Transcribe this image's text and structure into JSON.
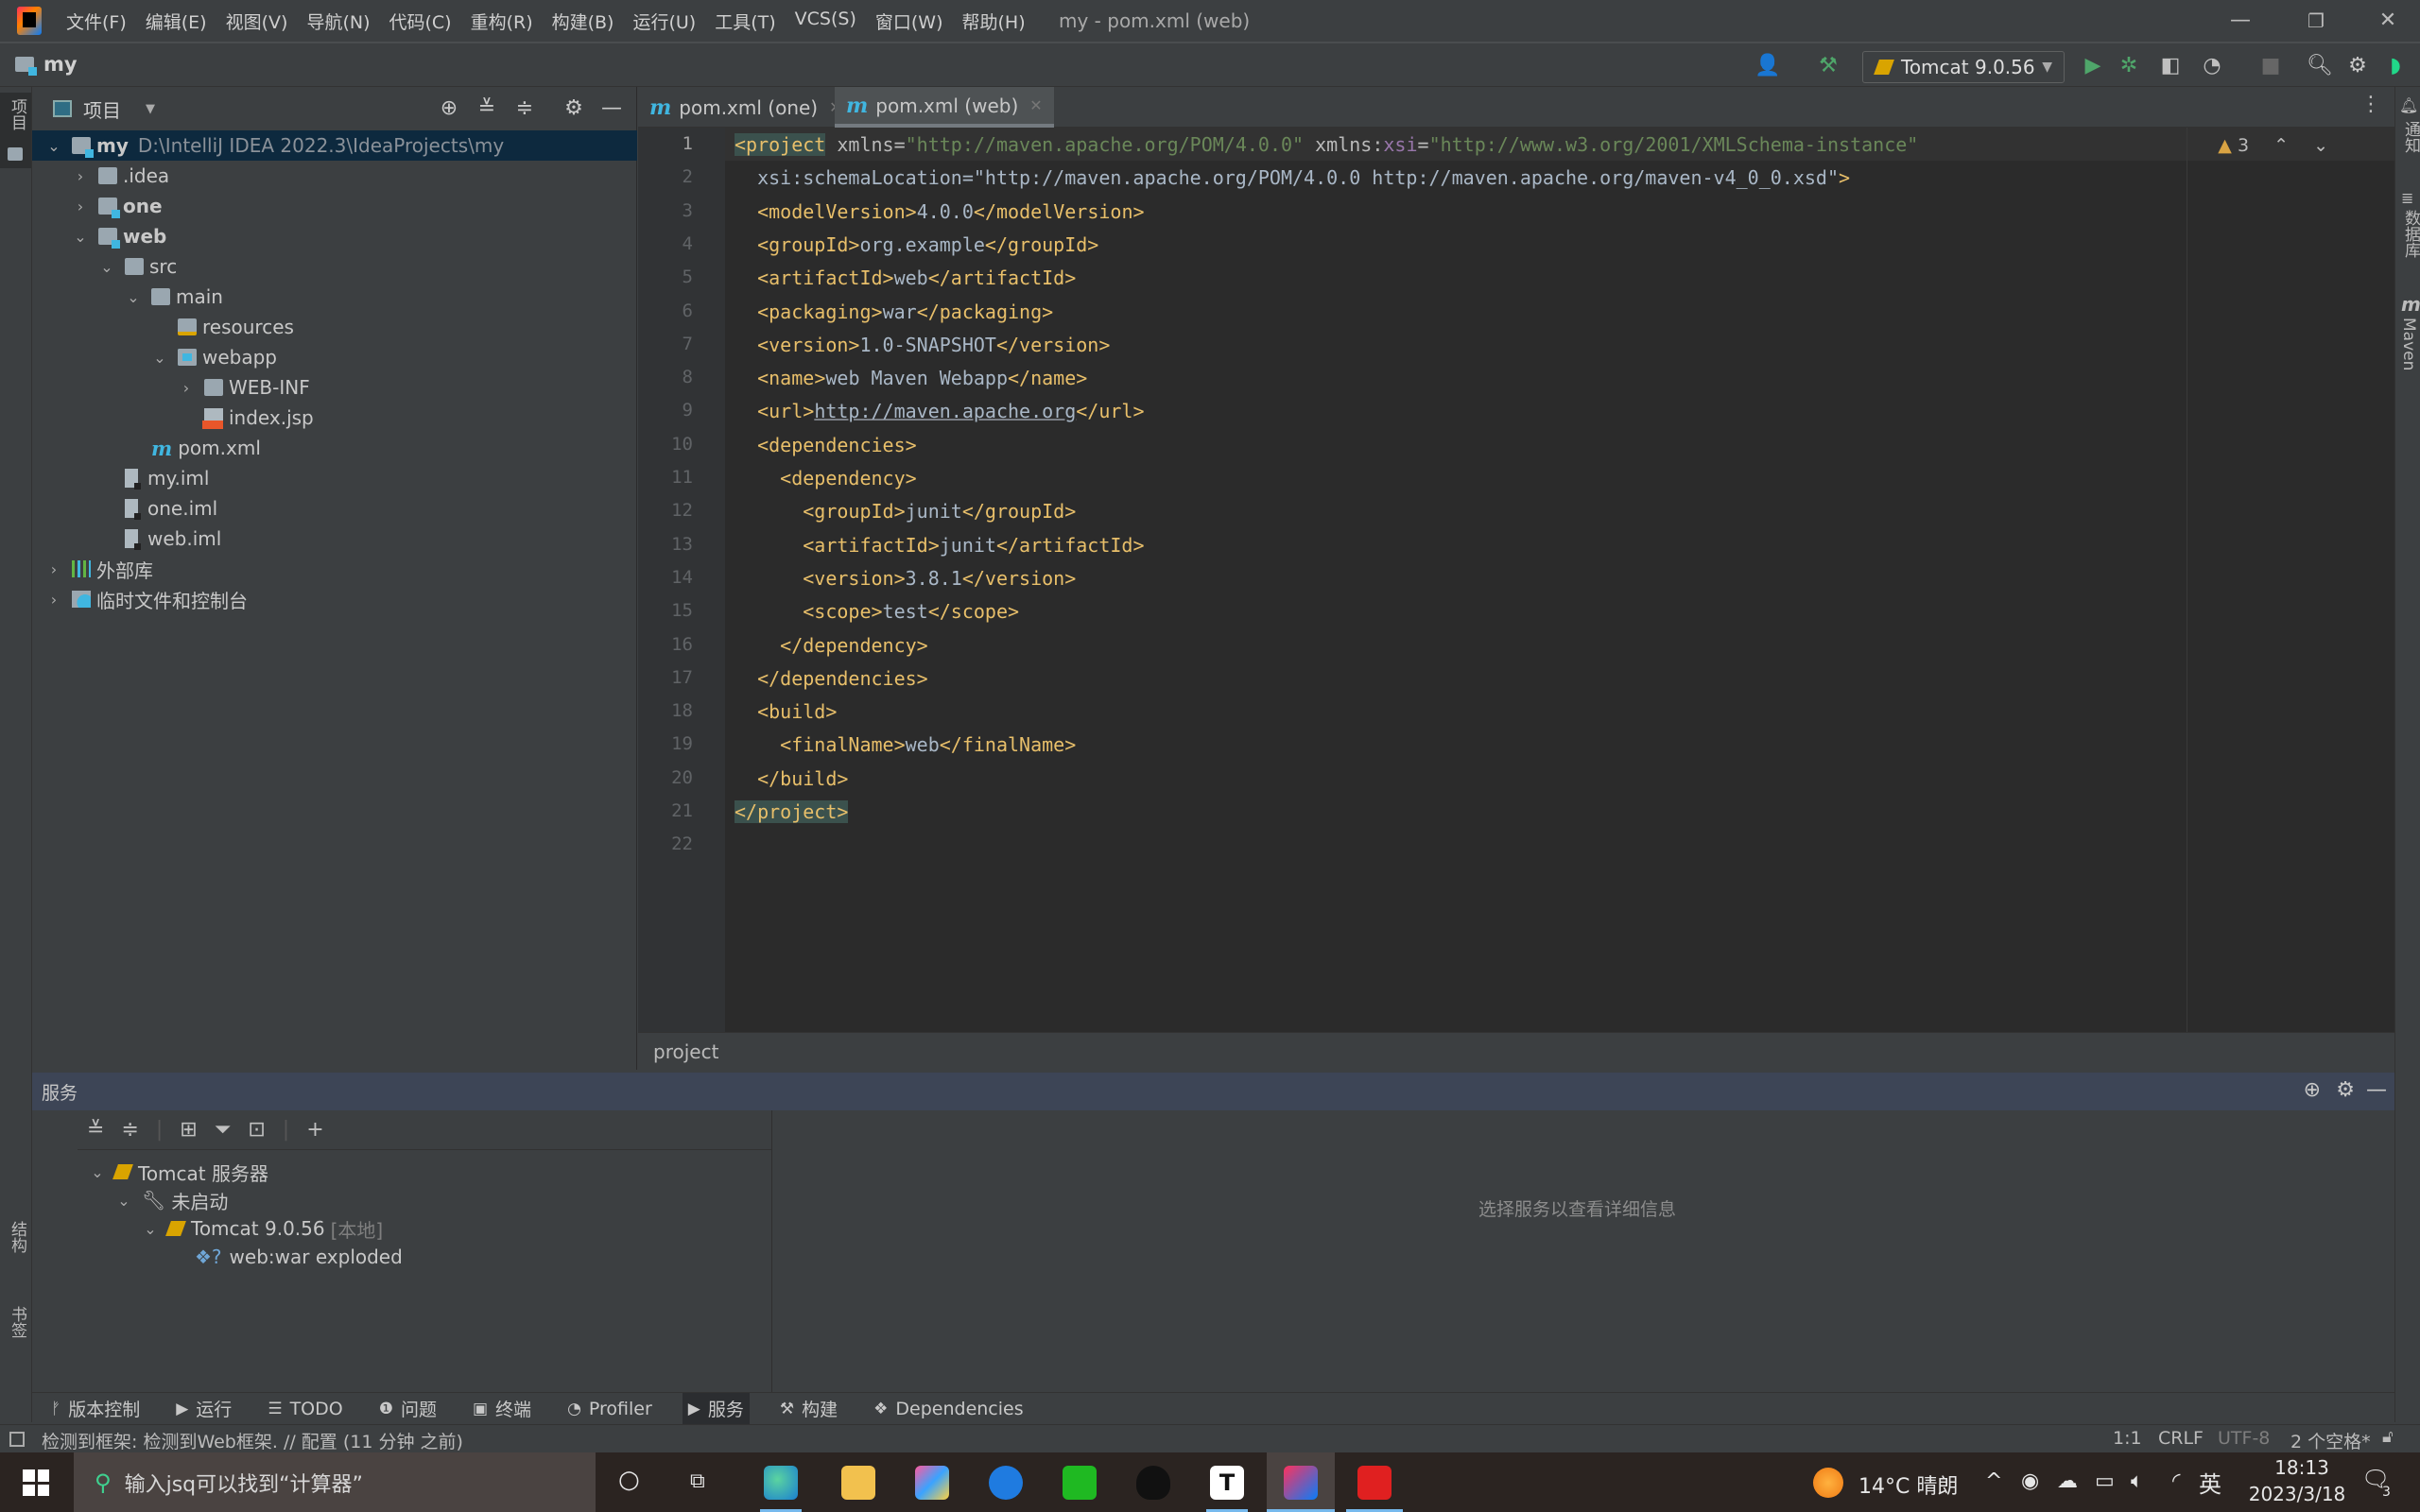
{
  "titlebar": {
    "menus": [
      "文件(F)",
      "编辑(E)",
      "视图(V)",
      "导航(N)",
      "代码(C)",
      "重构(R)",
      "构建(B)",
      "运行(U)",
      "工具(T)",
      "VCS(S)",
      "窗口(W)",
      "帮助(H)"
    ],
    "title": "my - pom.xml (web)",
    "minimize": "—",
    "restore": "❐",
    "close": "✕"
  },
  "navbar": {
    "project": "my",
    "run_config": "Tomcat 9.0.56"
  },
  "left_strip": {
    "project": "项目",
    "structure": "结构",
    "bookmarks": "书签"
  },
  "right_strip": {
    "notifications": "通知",
    "database": "数据库",
    "maven": "Maven"
  },
  "project_panel": {
    "title": "项目",
    "tree": [
      {
        "label": "my",
        "extra": "D:\\IntelliJ IDEA 2022.3\\IdeaProjects\\my",
        "icon": "module-folder",
        "expanded": true,
        "bold": true,
        "depth": 0,
        "selected": true
      },
      {
        "label": ".idea",
        "icon": "folder",
        "expanded": false,
        "depth": 1
      },
      {
        "label": "one",
        "icon": "module-folder",
        "expanded": false,
        "bold": true,
        "depth": 1
      },
      {
        "label": "web",
        "icon": "module-folder",
        "expanded": true,
        "bold": true,
        "depth": 1
      },
      {
        "label": "src",
        "icon": "folder",
        "expanded": true,
        "depth": 2
      },
      {
        "label": "main",
        "icon": "folder",
        "expanded": true,
        "depth": 3
      },
      {
        "label": "resources",
        "icon": "resources-folder",
        "depth": 4
      },
      {
        "label": "webapp",
        "icon": "web-folder",
        "expanded": true,
        "depth": 4
      },
      {
        "label": "WEB-INF",
        "icon": "folder",
        "expanded": false,
        "depth": 5
      },
      {
        "label": "index.jsp",
        "icon": "jsp-file",
        "depth": 5
      },
      {
        "label": "pom.xml",
        "icon": "maven-file",
        "depth": 3
      },
      {
        "label": "my.iml",
        "icon": "iml-file",
        "depth": 2
      },
      {
        "label": "one.iml",
        "icon": "iml-file",
        "depth": 2
      },
      {
        "label": "web.iml",
        "icon": "iml-file",
        "depth": 2
      },
      {
        "label": "外部库",
        "icon": "library",
        "expanded": false,
        "depth": 0
      },
      {
        "label": "临时文件和控制台",
        "icon": "scratches",
        "expanded": false,
        "depth": 0
      }
    ]
  },
  "editor": {
    "tabs": [
      {
        "label": "pom.xml (one)",
        "active": false
      },
      {
        "label": "pom.xml (web)",
        "active": true
      }
    ],
    "warnings": "3",
    "breadcrumb": "project",
    "lines": [
      "<project xmlns=\"http://maven.apache.org/POM/4.0.0\" xmlns:xsi=\"http://www.w3.org/2001/XMLSchema-instance\"",
      "  xsi:schemaLocation=\"http://maven.apache.org/POM/4.0.0 http://maven.apache.org/maven-v4_0_0.xsd\">",
      "  <modelVersion>4.0.0</modelVersion>",
      "  <groupId>org.example</groupId>",
      "  <artifactId>web</artifactId>",
      "  <packaging>war</packaging>",
      "  <version>1.0-SNAPSHOT</version>",
      "  <name>web Maven Webapp</name>",
      "  <url>http://maven.apache.org</url>",
      "  <dependencies>",
      "    <dependency>",
      "      <groupId>junit</groupId>",
      "      <artifactId>junit</artifactId>",
      "      <version>3.8.1</version>",
      "      <scope>test</scope>",
      "    </dependency>",
      "  </dependencies>",
      "  <build>",
      "    <finalName>web</finalName>",
      "  </build>",
      "</project>",
      ""
    ]
  },
  "services": {
    "title": "服务",
    "tree": [
      {
        "label": "Tomcat 服务器",
        "icon": "tomcat",
        "depth": 0
      },
      {
        "label": "未启动",
        "icon": "wrench",
        "depth": 1
      },
      {
        "label": "Tomcat 9.0.56",
        "suffix": "[本地]",
        "icon": "tomcat",
        "depth": 2
      },
      {
        "label": "web:war exploded",
        "icon": "artifact",
        "depth": 3
      }
    ],
    "empty_message": "选择服务以查看详细信息"
  },
  "bottom_tools": [
    {
      "label": "版本控制",
      "icon": "vcs-icon"
    },
    {
      "label": "运行",
      "icon": "run-icon"
    },
    {
      "label": "TODO",
      "icon": "todo-icon"
    },
    {
      "label": "问题",
      "icon": "problems-icon"
    },
    {
      "label": "终端",
      "icon": "terminal-icon"
    },
    {
      "label": "Profiler",
      "icon": "profiler-icon"
    },
    {
      "label": "服务",
      "icon": "services-icon",
      "active": true
    },
    {
      "label": "构建",
      "icon": "build-icon"
    },
    {
      "label": "Dependencies",
      "icon": "dependencies-icon"
    }
  ],
  "statusbar": {
    "message": "检测到框架: 检测到Web框架. // 配置 (11 分钟 之前)",
    "position": "1:1",
    "line_sep": "CRLF",
    "encoding": "UTF-8",
    "indent": "2 个空格*"
  },
  "taskbar": {
    "search_placeholder": "输入jsq可以找到“计算器”",
    "weather": "14°C 晴朗",
    "ime": "英",
    "time": "18:13",
    "date": "2023/3/18",
    "notifications": "3"
  }
}
